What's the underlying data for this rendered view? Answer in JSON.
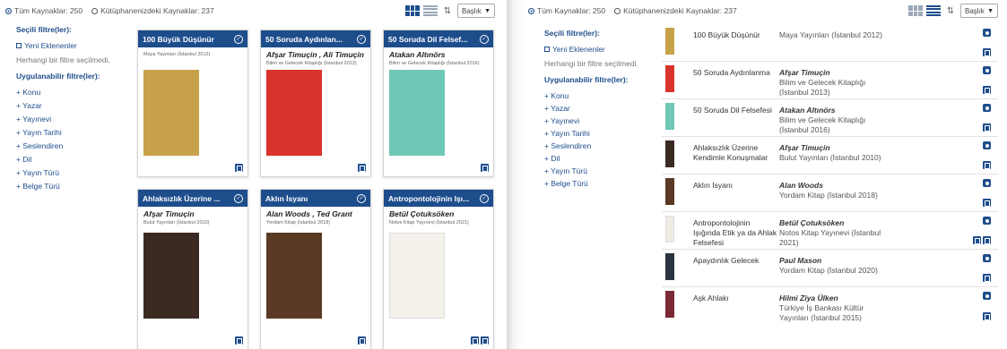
{
  "left": {
    "radio_all": "Tüm Kaynaklar: 250",
    "radio_library": "Kütüphanenizdeki Kaynaklar: 237",
    "sort_select": "Başlık",
    "sidebar": {
      "selected_heading": "Seçili filtre(ler):",
      "new_label": "Yeni Eklenenler",
      "no_filter": "Herhangi bir filtre seçilmedi.",
      "applicable_heading": "Uygulanabilir filtre(ler):",
      "filters": [
        "+ Konu",
        "+ Yazar",
        "+ Yayınevi",
        "+ Yayın Tarihi",
        "+ Seslendiren",
        "+ Dil",
        "+ Yayın Türü",
        "+ Belge Türü"
      ]
    },
    "cards": [
      {
        "title": "100 Büyük Düşünür",
        "author": "",
        "publisher": "Maya Yayınları (İstanbul 2012)",
        "cover_color": "#c8a24a"
      },
      {
        "title": "50 Soruda Aydınlan...",
        "author": "Afşar Timuçin , Ali Timuçin",
        "publisher": "Bilim ve Gelecek Kitaplığı (İstanbul 2013)",
        "cover_color": "#d9332b"
      },
      {
        "title": "50 Soruda Dil Felsef...",
        "author": "Atakan Altınörs",
        "publisher": "Bilim ve Gelecek Kitaplığı (İstanbul 2016)",
        "cover_color": "#6fc7b6"
      },
      {
        "title": "Ahlaksızlık Üzerine ...",
        "author": "Afşar Timuçin",
        "publisher": "Bulut Yayınları (İstanbul 2010)",
        "cover_color": "#3b2a22"
      },
      {
        "title": "Aklın İsyanı",
        "author": "Alan Woods , Ted Grant",
        "publisher": "Yordam Kitap (İstanbul 2018)",
        "cover_color": "#5a3a24"
      },
      {
        "title": "Antropontolojinin Işı...",
        "author": "Betül Çotuksöken",
        "publisher": "Notos Kitap Yayınevi (İstanbul 2021)",
        "cover_color": "#f4f1ea"
      }
    ]
  },
  "right": {
    "radio_all": "Tüm Kaynaklar: 250",
    "radio_library": "Kütüphanenizdeki Kaynaklar: 237",
    "sort_select": "Başlık",
    "sidebar": {
      "selected_heading": "Seçili filtre(ler):",
      "new_label": "Yeni Eklenenler",
      "no_filter": "Herhangi bir filtre seçilmedi.",
      "applicable_heading": "Uygulanabilir filtre(ler):",
      "filters": [
        "+ Konu",
        "+ Yazar",
        "+ Yayınevi",
        "+ Yayın Tarihi",
        "+ Seslendiren",
        "+ Dil",
        "+ Yayın Türü",
        "+ Belge Türü"
      ]
    },
    "rows": [
      {
        "title": "100 Büyük Düşünür",
        "author": "",
        "publisher": "Maya Yayınları (İstanbul 2012)",
        "thumb": "#c8a24a"
      },
      {
        "title": "50 Soruda Aydınlanma",
        "author": "Afşar Timuçin",
        "publisher": "Bilim ve Gelecek Kitaplığı (İstanbul 2013)",
        "thumb": "#d9332b"
      },
      {
        "title": "50 Soruda Dil Felsefesi",
        "author": "Atakan Altınörs",
        "publisher": "Bilim ve Gelecek Kitaplığı (İstanbul 2016)",
        "thumb": "#6fc7b6"
      },
      {
        "title": "Ahlaksızlık Üzerine Kendimle Konuşmalar",
        "author": "Afşar Timuçin",
        "publisher": "Bulut Yayınları (İstanbul 2010)",
        "thumb": "#3b2a22"
      },
      {
        "title": "Aklın İsyanı",
        "author": "Alan Woods",
        "publisher": "Yordam Kitap (İstanbul 2018)",
        "thumb": "#5a3a24"
      },
      {
        "title": "Antropontolojinin Işığında Etik ya da Ahlak Felsefesi",
        "author": "Betül Çotuksöken",
        "publisher": "Notos Kitap Yayınevi (İstanbul 2021)",
        "thumb": "#efece4"
      },
      {
        "title": "Apaydınlık Gelecek",
        "author": "Paul Mason",
        "publisher": "Yordam Kitap (İstanbul 2020)",
        "thumb": "#2a3340"
      },
      {
        "title": "Aşk Ahlakı",
        "author": "Hilmi Ziya Ülken",
        "publisher": "Türkiye İş Bankası Kültür Yayınları (İstanbul 2015)",
        "thumb": "#7a2a35"
      }
    ]
  }
}
